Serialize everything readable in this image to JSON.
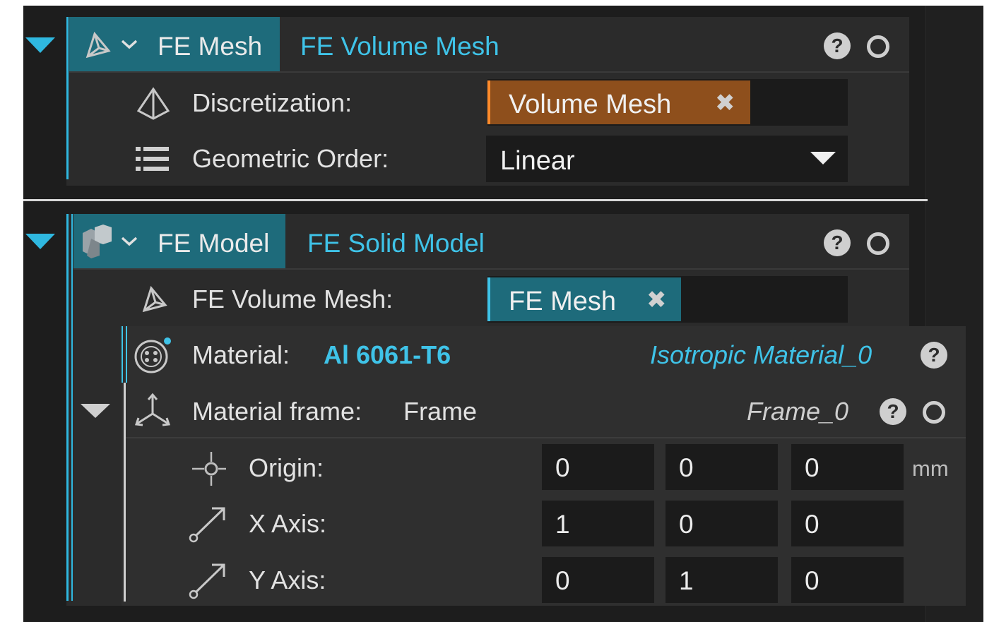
{
  "colors": {
    "accent": "#3fc3e8",
    "selected_header": "#1e6b7b",
    "orange_tag": "#8e4f1c",
    "panel_bg": "#2b2b2b",
    "field_bg": "#1b1b1b"
  },
  "mesh_block": {
    "header": {
      "type_label": "FE Mesh",
      "name": "FE Volume Mesh",
      "help": "?"
    },
    "discretization": {
      "label": "Discretization:",
      "value": "Volume Mesh",
      "remove": "✖"
    },
    "geometric_order": {
      "label": "Geometric Order:",
      "value": "Linear"
    },
    "icons": [
      "mesh-icon",
      "chevron-down-icon",
      "help-icon",
      "status-ring-icon",
      "pyramid-icon",
      "list-icon",
      "dropdown-arrow-icon"
    ]
  },
  "model_block": {
    "header": {
      "type_label": "FE Model",
      "name": "FE Solid Model",
      "help": "?"
    },
    "volume_mesh": {
      "label": "FE Volume Mesh:",
      "value": "FE Mesh",
      "remove": "✖"
    },
    "material": {
      "label": "Material:",
      "value": "Al 6061-T6",
      "type_name": "Isotropic Material_0",
      "help": "?"
    },
    "material_frame": {
      "label": "Material frame:",
      "value": "Frame",
      "name": "Frame_0",
      "help": "?",
      "rows": [
        {
          "label": "Origin:",
          "values": [
            "0",
            "0",
            "0"
          ],
          "unit": "mm"
        },
        {
          "label": "X Axis:",
          "values": [
            "1",
            "0",
            "0"
          ],
          "unit": ""
        },
        {
          "label": "Y Axis:",
          "values": [
            "0",
            "1",
            "0"
          ],
          "unit": ""
        }
      ]
    },
    "icons": [
      "solid-model-icon",
      "chevron-down-icon",
      "help-icon",
      "status-ring-icon",
      "mesh-icon",
      "material-icon",
      "frame-axes-icon",
      "origin-icon",
      "axis-arrow-icon"
    ]
  }
}
